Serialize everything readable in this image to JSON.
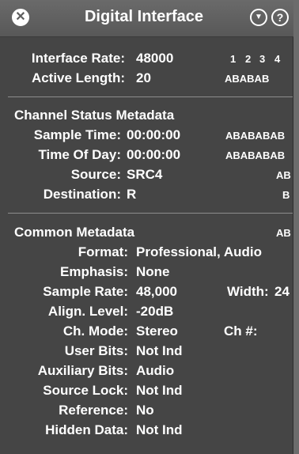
{
  "window": {
    "title": "Digital Interface",
    "close_glyph": "✕",
    "menu_glyph": "▼",
    "help_glyph": "?"
  },
  "interface": {
    "rate_label": "Interface Rate:",
    "rate_value": "48000",
    "channel_numbers": [
      "1",
      "2",
      "3",
      "4"
    ],
    "length_label": "Active Length:",
    "length_value": "20",
    "length_indicator": "ABABAB"
  },
  "channel_status": {
    "heading": "Channel Status Metadata",
    "rows": [
      {
        "label": "Sample Time:",
        "value": "00:00:00",
        "indicator": "ABABABAB"
      },
      {
        "label": "Time Of Day:",
        "value": "00:00:00",
        "indicator": "ABABABAB"
      },
      {
        "label": "Source:",
        "value": "SRC4",
        "indicator": "AB"
      },
      {
        "label": "Destination:",
        "value": "R",
        "indicator": "B"
      }
    ]
  },
  "common": {
    "heading": "Common Metadata",
    "heading_indicator": "AB",
    "rows": [
      {
        "label": "Format:",
        "value": "Professional, Audio"
      },
      {
        "label": "Emphasis:",
        "value": "None"
      },
      {
        "label": "Sample Rate:",
        "value": "48,000"
      },
      {
        "label": "Align. Level:",
        "value": "-20dB"
      },
      {
        "label": "Ch. Mode:",
        "value": "Stereo"
      },
      {
        "label": "User Bits:",
        "value": "Not Ind"
      },
      {
        "label": "Auxiliary Bits:",
        "value": "Audio"
      },
      {
        "label": "Source Lock:",
        "value": "Not Ind"
      },
      {
        "label": "Reference:",
        "value": "No"
      },
      {
        "label": "Hidden Data:",
        "value": "Not Ind"
      }
    ],
    "width_label": "Width:",
    "width_value": "24",
    "ch_num_label": "Ch #:"
  },
  "colors": {
    "panel": "#454545",
    "titlebar": "#5f5f5f",
    "text": "#ffffff",
    "separator": "#8d8d8d"
  }
}
